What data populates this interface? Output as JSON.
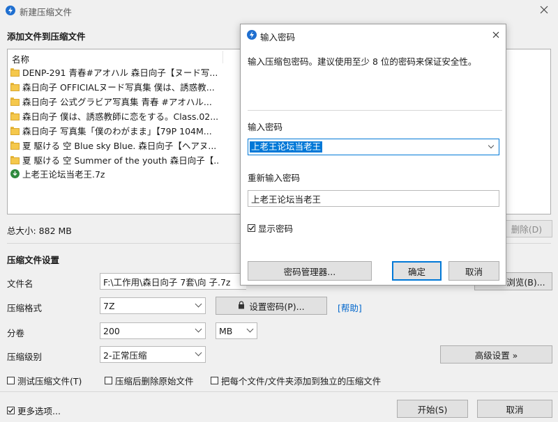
{
  "main_window": {
    "title": "新建压缩文件",
    "add_section_title": "添加文件到压缩文件",
    "list_header": "名称",
    "files": [
      {
        "name": "DENP-291 青春#アオハル 森日向子【ヌード写...",
        "icon": "folder-icon"
      },
      {
        "name": "森日向子 OFFICIALヌード写真集 僕は、誘惑教...",
        "icon": "folder-icon"
      },
      {
        "name": "森日向子 公式グラビア写真集 青春 #アオハル...",
        "icon": "folder-icon"
      },
      {
        "name": "森日向子 僕は、誘惑教師に恋をする。Class.02...",
        "icon": "folder-icon"
      },
      {
        "name": "森日向子 写真集「僕のわがまま」【79P 104M...",
        "icon": "folder-icon"
      },
      {
        "name": "夏 駆ける 空 Blue sky Blue. 森日向子【ヘアヌ...",
        "icon": "folder-icon"
      },
      {
        "name": "夏 駆ける 空 Summer of the youth 森日向子【...",
        "icon": "folder-icon"
      },
      {
        "name": "上老王论坛当老王.7z",
        "icon": "archive-icon"
      }
    ],
    "total_size": "总大小: 882 MB",
    "delete_button": "删除(D)",
    "settings_section_title": "压缩文件设置",
    "filename_label": "文件名",
    "filename_value": "F:\\工作用\\森日向子 7套\\向 子.7z",
    "browse_button": "浏览(B)...",
    "format_label": "压缩格式",
    "format_value": "7Z",
    "set_password_button": "设置密码(P)...",
    "help_link": "[帮助]",
    "volume_label": "分卷",
    "volume_value": "200",
    "volume_unit": "MB",
    "level_label": "压缩级别",
    "level_value": "2-正常压缩",
    "advanced_button": "高级设置 »",
    "test_checkbox": "测试压缩文件(T)",
    "delete_after_checkbox": "压缩后删除原始文件",
    "separate_checkbox": "把每个文件/文件夹添加到独立的压缩文件",
    "more_options_checkbox": "更多选项...",
    "start_button": "开始(S)",
    "cancel_button": "取消"
  },
  "dialog": {
    "title": "输入密码",
    "description": "输入压缩包密码。建议使用至少 8 位的密码来保证安全性。",
    "password_label": "输入密码",
    "password_value": "上老王论坛当老王",
    "confirm_label": "重新输入密码",
    "confirm_value": "上老王论坛当老王",
    "show_password_checkbox": "显示密码",
    "show_password_checked": true,
    "password_manager_button": "密码管理器...",
    "ok_button": "确定",
    "cancel_button": "取消"
  },
  "colors": {
    "accent": "#0078d7",
    "link": "#0066cc",
    "selection": "#0078d7",
    "background": "#f0f0f0",
    "dialog_background": "#ffffff"
  }
}
